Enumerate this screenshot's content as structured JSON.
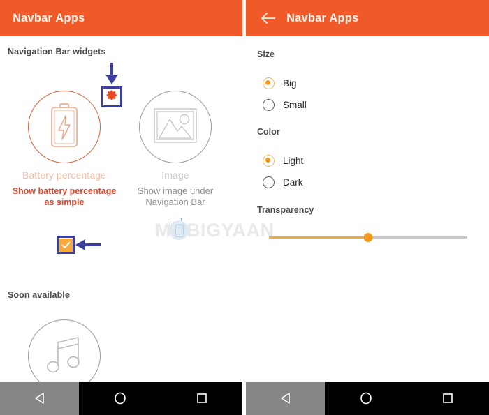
{
  "app": {
    "accent_orange": "#f05a28",
    "annotation_blue": "#3b3fa0",
    "slider_orange": "#f0981f",
    "checkbox_orange": "#f5a93f"
  },
  "left_panel": {
    "appbar": {
      "title": "Navbar Apps"
    },
    "sections": [
      {
        "label": "Navigation Bar widgets"
      },
      {
        "label": "Soon available"
      }
    ],
    "widgets": [
      {
        "icon": "battery-icon",
        "name": "Battery percentage",
        "description": "Show battery percentage as simple",
        "checked": true,
        "checkbox_state": "checked"
      },
      {
        "icon": "image-icon",
        "name": "Image",
        "description": "Show image under Navigation Bar",
        "checked": false,
        "checkbox_state": "unchecked"
      },
      {
        "icon": "music-note-icon",
        "name": "",
        "description": "",
        "checked": false,
        "checkbox_state": "none"
      }
    ],
    "annotations": {
      "gear_icon": "gear-icon",
      "arrow_down": "arrow-down-annotation",
      "arrow_left": "arrow-left-annotation"
    }
  },
  "right_panel": {
    "appbar": {
      "back": "back-arrow-icon",
      "title": "Navbar Apps"
    },
    "settings": [
      {
        "label": "Size",
        "type": "radio-group",
        "options": [
          {
            "label": "Big",
            "selected": true
          },
          {
            "label": "Small",
            "selected": false
          }
        ]
      },
      {
        "label": "Color",
        "type": "radio-group",
        "options": [
          {
            "label": "Light",
            "selected": true
          },
          {
            "label": "Dark",
            "selected": false
          }
        ]
      },
      {
        "label": "Transparency",
        "type": "slider",
        "value_percent": 50
      }
    ]
  },
  "watermark": {
    "text_before": "M",
    "logo": "phone-circle-logo",
    "text_after": "BIGYAAN"
  },
  "system_navbar": {
    "buttons": [
      {
        "name": "back-nav-button",
        "glyph": "back-triangle-icon"
      },
      {
        "name": "home-nav-button",
        "glyph": "home-circle-icon"
      },
      {
        "name": "recents-nav-button",
        "glyph": "recents-square-icon"
      }
    ]
  }
}
